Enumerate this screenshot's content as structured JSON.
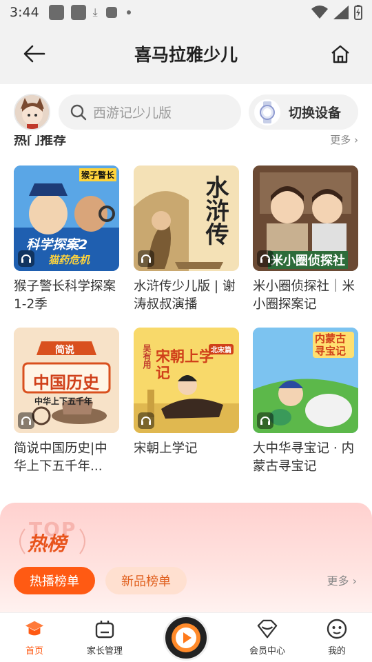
{
  "status_bar": {
    "time": "3:44"
  },
  "header": {
    "title": "喜马拉雅少儿"
  },
  "search": {
    "placeholder": "西游记少儿版"
  },
  "device_button": {
    "label": "切换设备"
  },
  "section": {
    "title": "热门推荐",
    "more": "更多"
  },
  "albums": [
    {
      "title": "猴子警长科学探案1-2季",
      "cover_text_top": "猴子警长",
      "cover_text_main": "科学探案2",
      "cover_text_sub": "猫药危机",
      "color": "#2f7ad0"
    },
    {
      "title": "水浒传少儿版 | 谢涛叔叔演播",
      "cover_text_main": "水浒传",
      "color": "#f4e1b6"
    },
    {
      "title": "米小圈侦探社｜米小圈探案记",
      "cover_text_main": "米小圈侦探社",
      "color": "#6b4a34"
    },
    {
      "title": "简说中国历史|中华上下五千年...",
      "cover_text_top": "简说",
      "cover_text_main": "中国历史",
      "cover_text_sub": "中华上下五千年",
      "color": "#f7e2c8"
    },
    {
      "title": "宋朝上学记",
      "cover_text_top": "吴有用",
      "cover_text_main": "宋朝上学记",
      "cover_text_sub": "北宋篇",
      "color": "#f6c93b"
    },
    {
      "title": "大中华寻宝记 · 内蒙古寻宝记",
      "cover_text_main": "内蒙古寻宝记",
      "color": "#4aa3e0"
    }
  ],
  "top_chart": {
    "logo_en": "TOP",
    "logo": "热榜",
    "tabs": [
      {
        "label": "热播榜单"
      },
      {
        "label": "新品榜单"
      }
    ],
    "more": "更多"
  },
  "bottom_nav": {
    "items": [
      {
        "label": "首页"
      },
      {
        "label": "家长管理"
      },
      {
        "label": "会员中心"
      },
      {
        "label": "我的"
      }
    ]
  },
  "colors": {
    "accent": "#ff5a13",
    "accent_light": "#ffe0d0"
  }
}
